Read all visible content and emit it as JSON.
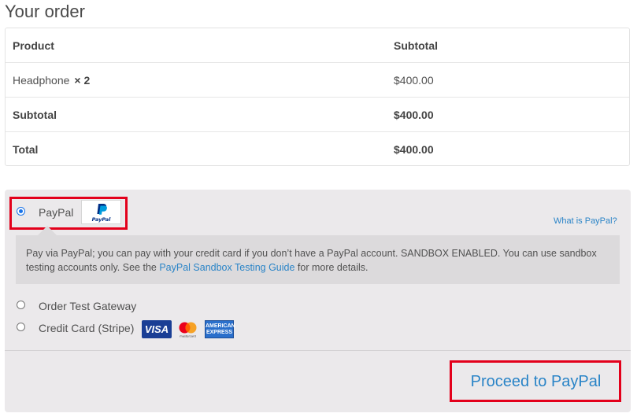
{
  "heading": "Your order",
  "table": {
    "headers": {
      "product": "Product",
      "subtotal": "Subtotal"
    },
    "items": [
      {
        "name": "Headphone",
        "qty": "× 2",
        "subtotal": "$400.00"
      }
    ],
    "subtotal": {
      "label": "Subtotal",
      "value": "$400.00"
    },
    "total": {
      "label": "Total",
      "value": "$400.00"
    }
  },
  "payment": {
    "methods": [
      {
        "label": "PayPal",
        "selected": true,
        "logo": "PayPal"
      },
      {
        "label": "Order Test Gateway",
        "selected": false
      },
      {
        "label": "Credit Card (Stripe)",
        "selected": false
      }
    ],
    "what_link": "What is PayPal?",
    "description": {
      "part1": "Pay via PayPal; you can pay with your credit card if you don’t have a PayPal account. SANDBOX ENABLED. You can use sandbox testing accounts only. See the ",
      "link": "PayPal Sandbox Testing Guide",
      "part2": " for more details."
    },
    "cards": {
      "visa": "VISA",
      "mastercard": "mastercard",
      "amex_top": "AMERICAN",
      "amex_bottom": "EXPRESS"
    }
  },
  "button": {
    "label": "Proceed to PayPal"
  },
  "colors": {
    "accent": "#2a84c7",
    "highlight": "#e3001b",
    "panel": "#ebe9eb"
  }
}
